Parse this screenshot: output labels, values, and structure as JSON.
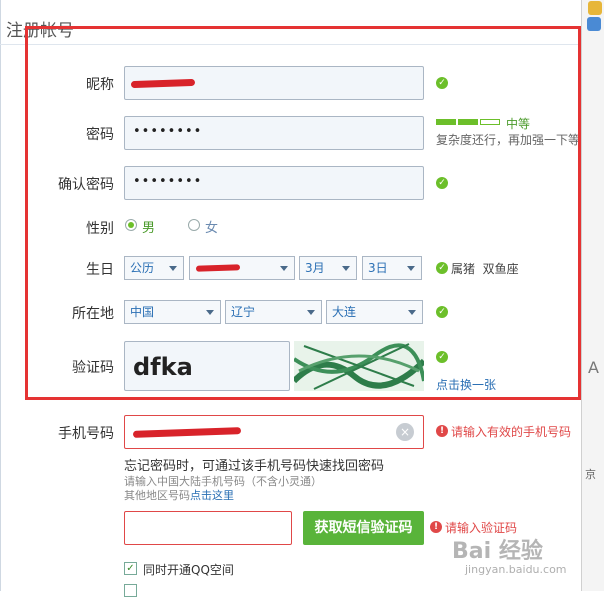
{
  "page": {
    "title": "注册帐号"
  },
  "form": {
    "nickname": {
      "label": "昵称"
    },
    "password": {
      "label": "密码",
      "masked": "••••••••",
      "strength_label": "中等",
      "strength_level": 0.67,
      "strength_hint": "复杂度还行，再加强一下等"
    },
    "confirm": {
      "label": "确认密码",
      "masked": "••••••••"
    },
    "gender": {
      "label": "性别",
      "male": "男",
      "female": "女"
    },
    "birthday": {
      "label": "生日",
      "calendar": "公历",
      "month": "3月",
      "day": "3日",
      "zodiac": "属猪  双鱼座"
    },
    "location": {
      "label": "所在地",
      "country": "中国",
      "province": "辽宁",
      "city": "大连"
    },
    "captcha": {
      "label": "验证码",
      "value": "dfka",
      "refresh": "点击换一张"
    },
    "phone": {
      "label": "手机号码",
      "error": "请输入有效的手机号码",
      "hint1": "忘记密码时，可通过该手机号码快速找回密码",
      "hint2": "请输入中国大陆手机号码（不含小灵通）",
      "hint3_prefix": "其他地区号码",
      "hint3_link": "点击这里"
    },
    "sms": {
      "button": "获取短信验证码",
      "error": "请输入验证码"
    },
    "qzone": {
      "label": "同时开通QQ空间"
    }
  },
  "side": {
    "label": "京"
  },
  "watermark": {
    "brand": "Bai 经验",
    "url": "jingyan.baidu.com"
  },
  "colors": {
    "accent_green": "#59b43a",
    "error_red": "#e04848",
    "highlight_box": "#e53333"
  }
}
